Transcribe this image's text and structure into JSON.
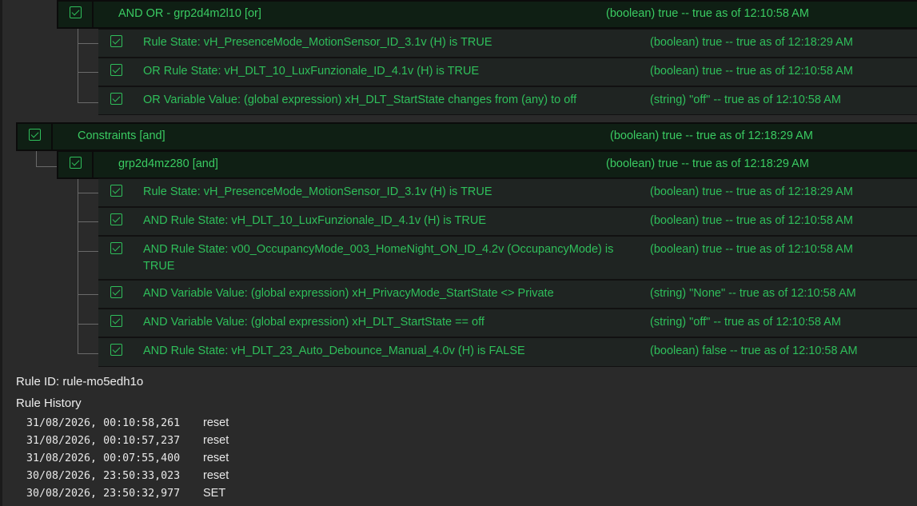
{
  "top_group": {
    "label": "AND OR - grp2d4m2l10 [or]",
    "value": "(boolean) true -- true as of 12:10:58 AM"
  },
  "top_items": [
    {
      "label": "Rule State: vH_PresenceMode_MotionSensor_ID_3.1v (H) is TRUE",
      "value": "(boolean) true -- true as of 12:18:29 AM"
    },
    {
      "label": "OR Rule State: vH_DLT_10_LuxFunzionale_ID_4.1v (H) is TRUE",
      "value": "(boolean) true -- true as of 12:10:58 AM"
    },
    {
      "label": "OR Variable Value: (global expression) xH_DLT_StartState changes from (any) to off",
      "value": "(string) \"off\" -- true as of 12:10:58 AM"
    }
  ],
  "constraints": {
    "label": "Constraints [and]",
    "value": "(boolean) true -- true as of 12:18:29 AM"
  },
  "sub_group": {
    "label": "grp2d4mz280 [and]",
    "value": "(boolean) true -- true as of 12:18:29 AM"
  },
  "sub_items": [
    {
      "label": "Rule State: vH_PresenceMode_MotionSensor_ID_3.1v (H) is TRUE",
      "value": "(boolean) true -- true as of 12:18:29 AM"
    },
    {
      "label": "AND Rule State: vH_DLT_10_LuxFunzionale_ID_4.1v (H) is TRUE",
      "value": "(boolean) true -- true as of 12:10:58 AM"
    },
    {
      "label": "AND Rule State: v00_OccupancyMode_003_HomeNight_ON_ID_4.2v (OccupancyMode) is TRUE",
      "value": "(boolean) true -- true as of 12:10:58 AM"
    },
    {
      "label": "AND Variable Value: (global expression) xH_PrivacyMode_StartState <> Private",
      "value": "(string) \"None\" -- true as of 12:10:58 AM"
    },
    {
      "label": "AND Variable Value: (global expression) xH_DLT_StartState == off",
      "value": "(string) \"off\" -- true as of 12:10:58 AM"
    },
    {
      "label": "AND Rule State: vH_DLT_23_Auto_Debounce_Manual_4.0v (H) is FALSE",
      "value": "(boolean) false -- true as of 12:10:58 AM"
    }
  ],
  "rule_id": "Rule ID: rule-mo5edh1o",
  "history_title": "Rule History",
  "history": [
    {
      "ts": "31/08/2026, 00:10:58,261",
      "event": "reset"
    },
    {
      "ts": "31/08/2026, 00:10:57,237",
      "event": "reset"
    },
    {
      "ts": "31/08/2026, 00:07:55,400",
      "event": "reset"
    },
    {
      "ts": "30/08/2026, 23:50:33,023",
      "event": "reset"
    },
    {
      "ts": "30/08/2026, 23:50:32,977",
      "event": "SET"
    }
  ],
  "colors": {
    "accent": "#2fbf5b",
    "background": "#2a2a2a"
  }
}
